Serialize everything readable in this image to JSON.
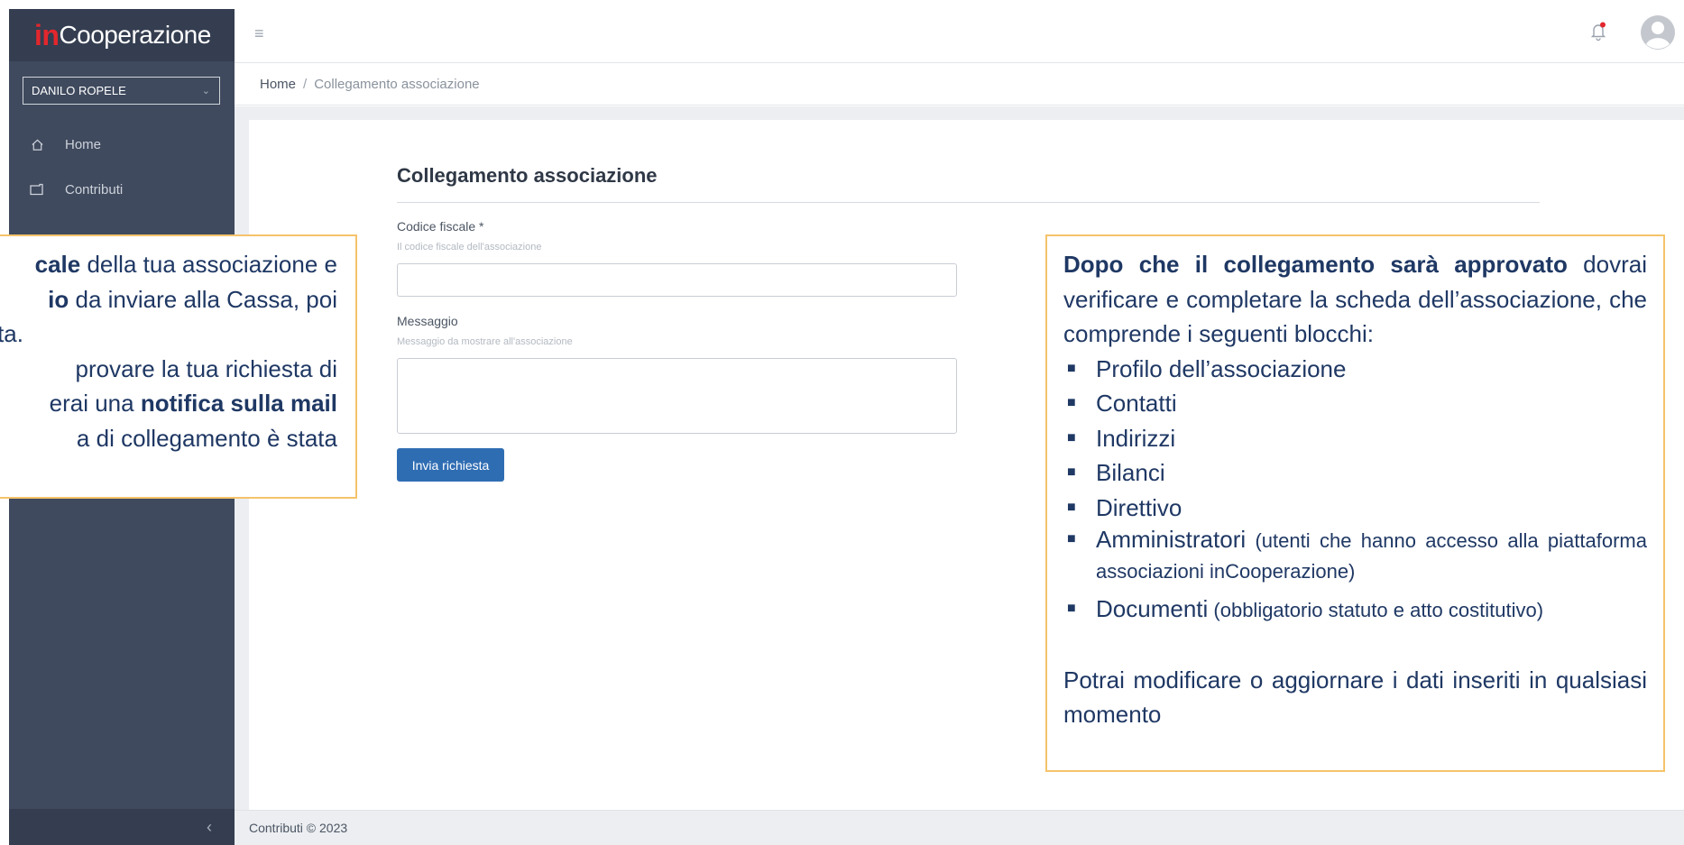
{
  "brand": {
    "prefix": "in",
    "name": "Cooperazione"
  },
  "user_select": {
    "value": "DANILO ROPELE"
  },
  "sidebar": {
    "items": [
      {
        "label": "Home",
        "icon": "home-icon"
      },
      {
        "label": "Contributi",
        "icon": "folder-icon"
      }
    ],
    "collapse_icon": "chevron-left-icon"
  },
  "breadcrumb": {
    "home": "Home",
    "separator": "/",
    "current": "Collegamento associazione"
  },
  "form": {
    "title": "Collegamento associazione",
    "codice_fiscale": {
      "label": "Codice fiscale *",
      "hint": "Il codice fiscale dell'associazione",
      "value": ""
    },
    "messaggio": {
      "label": "Messaggio",
      "hint": "Messaggio da mostrare all'associazione",
      "value": ""
    },
    "submit_label": "Invia richiesta"
  },
  "footer": {
    "text": "Contributi © 2023"
  },
  "callout_left": {
    "l1_bold": "cale",
    "l1_rest": " della tua associazione e",
    "l2_bold": "io",
    "l2_rest": " da inviare alla Cassa, poi",
    "l3": "ta.",
    "l4": "provare la tua richiesta di",
    "l5_pre": "erai una ",
    "l5_bold": "notifica sulla mail",
    "l6": "a di collegamento è stata"
  },
  "callout_right": {
    "intro_bold": "Dopo che il collegamento sarà approvato",
    "intro_rest": " dovrai verificare e completare la scheda dell’associazione, che comprende i seguenti blocchi:",
    "items": [
      {
        "text": "Profilo dell’associazione",
        "note": ""
      },
      {
        "text": "Contatti",
        "note": ""
      },
      {
        "text": "Indirizzi",
        "note": ""
      },
      {
        "text": "Bilanci",
        "note": ""
      },
      {
        "text": "Direttivo",
        "note": ""
      },
      {
        "text": "Amministratori",
        "note": " (utenti che hanno accesso alla piattaforma associazioni inCooperazione)"
      },
      {
        "text": "Documenti",
        "note": " (obbligatorio statuto e atto costitutivo)"
      }
    ],
    "outro": "Potrai modificare o aggiornare i dati inseriti in qualsiasi momento"
  },
  "colors": {
    "sidebar": "#3f4a5e",
    "brand_red": "#e3262d",
    "button": "#2f6db3",
    "callout_border": "#f5c36a",
    "callout_text": "#1f3864"
  }
}
